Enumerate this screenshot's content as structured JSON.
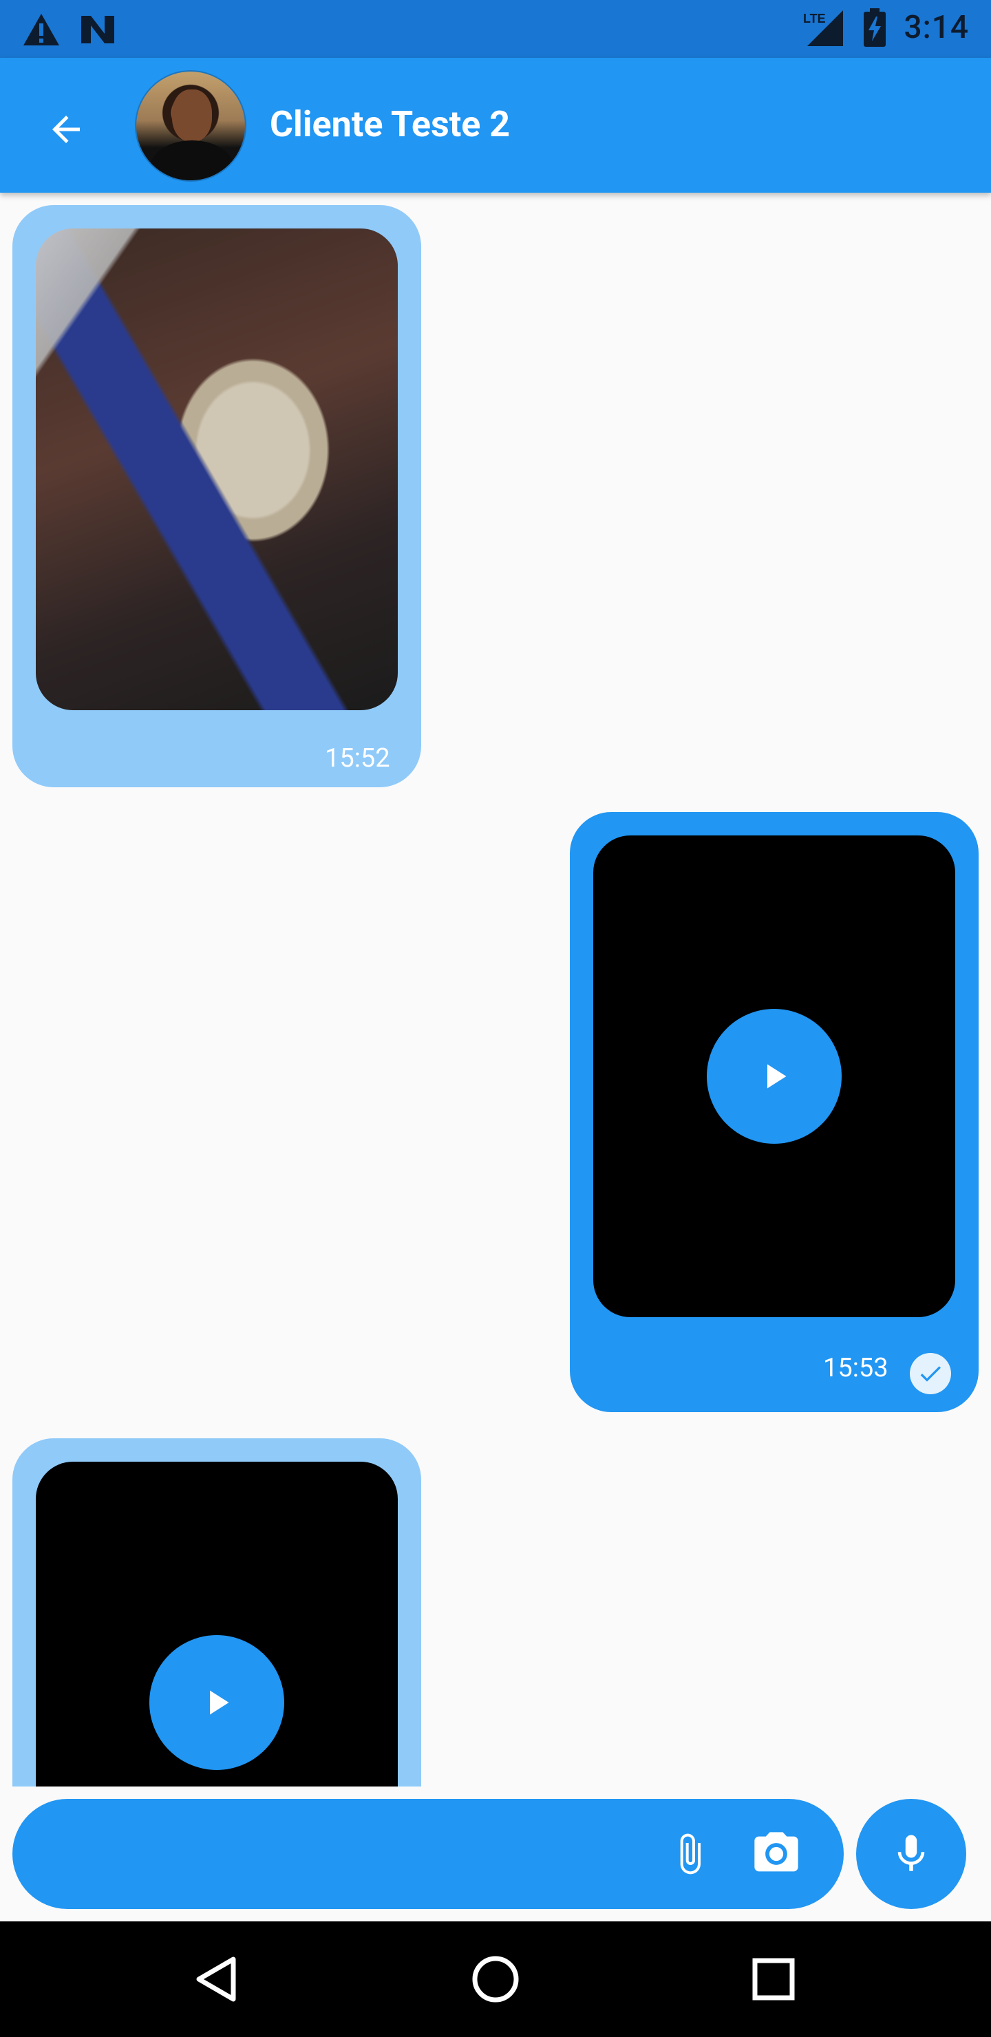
{
  "status_bar": {
    "time": "3:14",
    "network": "LTE",
    "icons": [
      "warning-icon",
      "n-notification-icon",
      "signal-icon",
      "battery-charging-icon"
    ]
  },
  "header": {
    "contact_name": "Cliente Teste 2",
    "back_icon": "arrow-back-icon",
    "avatar_icon": "contact-avatar"
  },
  "messages": [
    {
      "direction": "received",
      "type": "image",
      "time": "15:52"
    },
    {
      "direction": "sent",
      "type": "video",
      "time": "15:53",
      "status_icon": "check-circle-icon"
    },
    {
      "direction": "received",
      "type": "video"
    }
  ],
  "composer": {
    "attach_icon": "paperclip-icon",
    "camera_icon": "camera-icon",
    "mic_icon": "microphone-icon"
  },
  "navigation": {
    "icons": [
      "back-triangle-icon",
      "home-circle-icon",
      "recents-square-icon"
    ]
  },
  "colors": {
    "primary": "#2196f3",
    "primary_dark": "#1976d2",
    "received_bubble": "#90caf9",
    "background": "#fafafa"
  }
}
